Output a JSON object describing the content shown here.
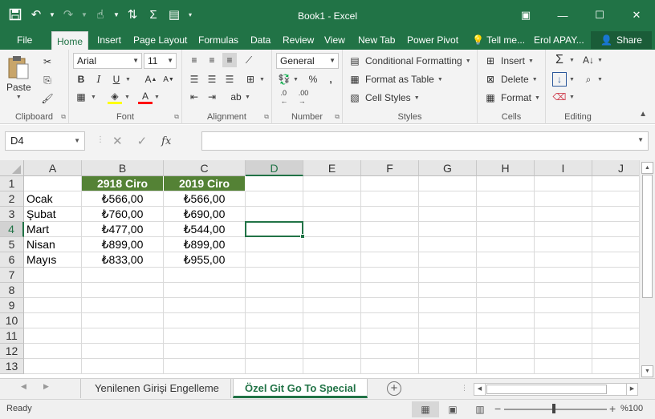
{
  "window": {
    "title": "Book1 - Excel"
  },
  "tabs": [
    "File",
    "Home",
    "Insert",
    "Page Layout",
    "Formulas",
    "Data",
    "Review",
    "View",
    "New Tab",
    "Power Pivot",
    "Tell me...",
    "Erol APAY..."
  ],
  "share_label": "Share",
  "ribbon": {
    "clipboard": {
      "paste": "Paste",
      "label": "Clipboard"
    },
    "font": {
      "name": "Arial",
      "size": "11",
      "label": "Font"
    },
    "alignment": {
      "label": "Alignment"
    },
    "number": {
      "format": "General",
      "label": "Number"
    },
    "styles": {
      "conditional": "Conditional Formatting",
      "table": "Format as Table",
      "cell": "Cell Styles",
      "label": "Styles"
    },
    "cells": {
      "insert": "Insert",
      "delete": "Delete",
      "format": "Format",
      "label": "Cells"
    },
    "editing": {
      "label": "Editing"
    }
  },
  "formula_bar": {
    "name_box": "D4",
    "fx": "fx",
    "content": ""
  },
  "sheet": {
    "columns": [
      "A",
      "B",
      "C",
      "D",
      "E",
      "F",
      "G",
      "H",
      "I",
      "J"
    ],
    "selected_column": "D",
    "selected_row": "4",
    "rows": [
      "1",
      "2",
      "3",
      "4",
      "5",
      "6",
      "7",
      "8",
      "9",
      "10",
      "11",
      "12",
      "13"
    ],
    "header": {
      "b": "2918 Ciro",
      "c": "2019 Ciro"
    },
    "data": [
      {
        "a": "Ocak",
        "b": "₺566,00",
        "c": "₺566,00"
      },
      {
        "a": "Şubat",
        "b": "₺760,00",
        "c": "₺690,00"
      },
      {
        "a": "Mart",
        "b": "₺477,00",
        "c": "₺544,00"
      },
      {
        "a": "Nisan",
        "b": "₺899,00",
        "c": "₺899,00"
      },
      {
        "a": "Mayıs",
        "b": "₺833,00",
        "c": "₺955,00"
      }
    ],
    "header_fill": "#548235"
  },
  "sheet_tabs": [
    "Yenilenen Girişi Engelleme",
    "Özel Git Go To Special"
  ],
  "active_sheet": "Özel Git Go To Special",
  "status": {
    "ready": "Ready",
    "zoom": "%100"
  },
  "colors": {
    "accent": "#217346"
  }
}
